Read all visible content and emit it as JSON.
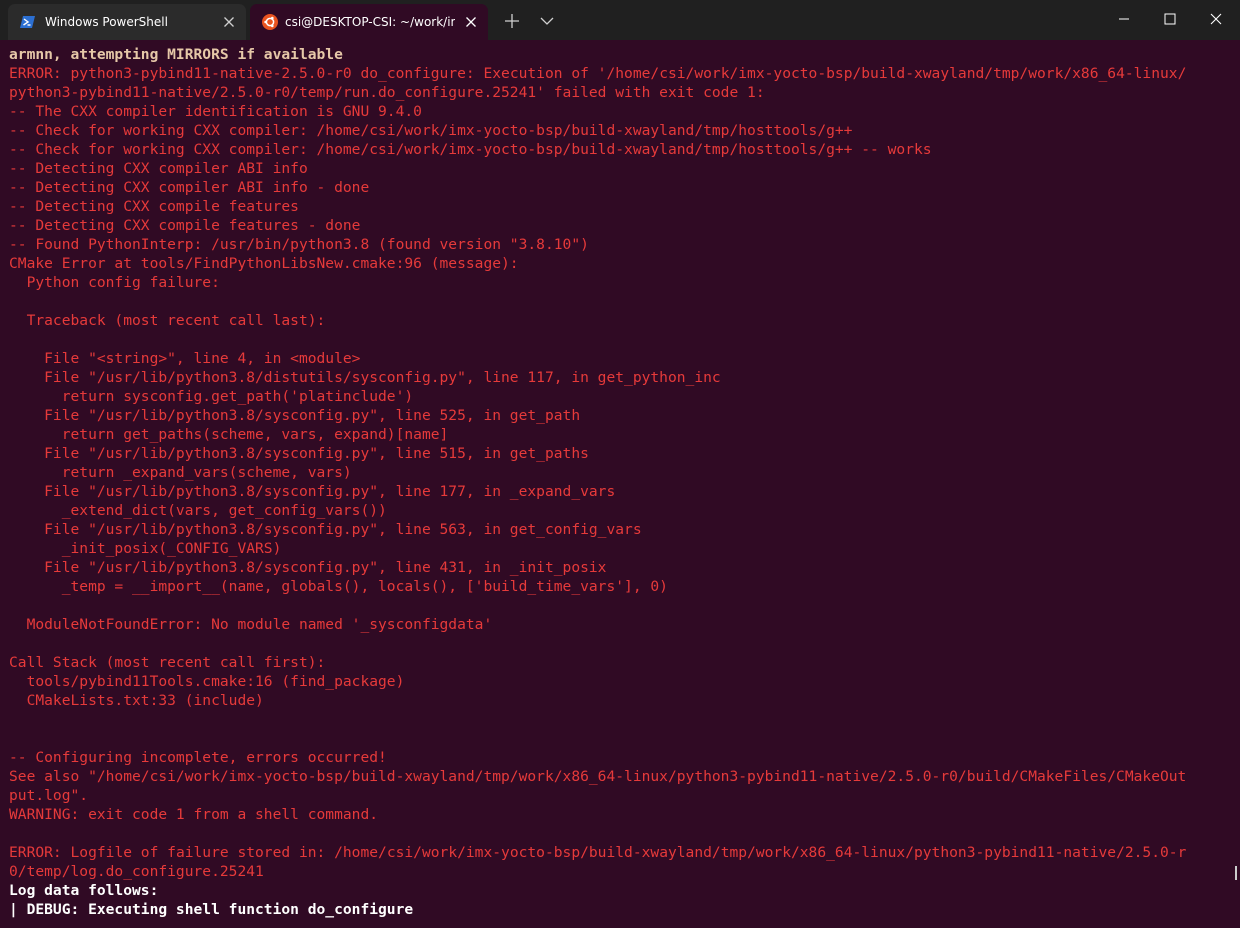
{
  "tabs": [
    {
      "label": "Windows PowerShell",
      "icon": "powershell-icon",
      "active": false
    },
    {
      "label": "csi@DESKTOP-CSI: ~/work/imx",
      "icon": "ubuntu-icon",
      "active": true
    }
  ],
  "colors": {
    "terminal_bg": "#300a24",
    "titlebar_bg": "#202020",
    "error_text": "#ff4d4d",
    "accent_ubuntu": "#e95420"
  },
  "terminal": {
    "lines": [
      {
        "parts": [
          {
            "c": "tan",
            "t": "armnn, attempting MIRRORS if available"
          }
        ]
      },
      {
        "parts": [
          {
            "c": "red",
            "t": "ERROR: "
          },
          {
            "c": "red",
            "t": "python3-pybind11-native-2.5.0-r0 do_configure: Execution of '/home/csi/work/imx-yocto-bsp/build-xwayland/tmp/work/x86_64-linux/"
          }
        ]
      },
      {
        "parts": [
          {
            "c": "red",
            "t": "python3-pybind11-native/2.5.0-r0/temp/run.do_configure.25241' failed with exit code 1:"
          }
        ]
      },
      {
        "parts": [
          {
            "c": "red",
            "t": "-- The CXX compiler identification is GNU 9.4.0"
          }
        ]
      },
      {
        "parts": [
          {
            "c": "red",
            "t": "-- Check for working CXX compiler: /home/csi/work/imx-yocto-bsp/build-xwayland/tmp/hosttools/g++"
          }
        ]
      },
      {
        "parts": [
          {
            "c": "red",
            "t": "-- Check for working CXX compiler: /home/csi/work/imx-yocto-bsp/build-xwayland/tmp/hosttools/g++ -- works"
          }
        ]
      },
      {
        "parts": [
          {
            "c": "red",
            "t": "-- Detecting CXX compiler ABI info"
          }
        ]
      },
      {
        "parts": [
          {
            "c": "red",
            "t": "-- Detecting CXX compiler ABI info - done"
          }
        ]
      },
      {
        "parts": [
          {
            "c": "red",
            "t": "-- Detecting CXX compile features"
          }
        ]
      },
      {
        "parts": [
          {
            "c": "red",
            "t": "-- Detecting CXX compile features - done"
          }
        ]
      },
      {
        "parts": [
          {
            "c": "red",
            "t": "-- Found PythonInterp: /usr/bin/python3.8 (found version \"3.8.10\")"
          }
        ]
      },
      {
        "parts": [
          {
            "c": "red",
            "t": "CMake Error at tools/FindPythonLibsNew.cmake:96 (message):"
          }
        ]
      },
      {
        "parts": [
          {
            "c": "red",
            "t": "  Python config failure:"
          }
        ]
      },
      {
        "parts": [
          {
            "c": "red",
            "t": ""
          }
        ]
      },
      {
        "parts": [
          {
            "c": "red",
            "t": "  Traceback (most recent call last):"
          }
        ]
      },
      {
        "parts": [
          {
            "c": "red",
            "t": ""
          }
        ]
      },
      {
        "parts": [
          {
            "c": "red",
            "t": "    File \"<string>\", line 4, in <module>"
          }
        ]
      },
      {
        "parts": [
          {
            "c": "red",
            "t": "    File \"/usr/lib/python3.8/distutils/sysconfig.py\", line 117, in get_python_inc"
          }
        ]
      },
      {
        "parts": [
          {
            "c": "red",
            "t": "      return sysconfig.get_path('platinclude')"
          }
        ]
      },
      {
        "parts": [
          {
            "c": "red",
            "t": "    File \"/usr/lib/python3.8/sysconfig.py\", line 525, in get_path"
          }
        ]
      },
      {
        "parts": [
          {
            "c": "red",
            "t": "      return get_paths(scheme, vars, expand)[name]"
          }
        ]
      },
      {
        "parts": [
          {
            "c": "red",
            "t": "    File \"/usr/lib/python3.8/sysconfig.py\", line 515, in get_paths"
          }
        ]
      },
      {
        "parts": [
          {
            "c": "red",
            "t": "      return _expand_vars(scheme, vars)"
          }
        ]
      },
      {
        "parts": [
          {
            "c": "red",
            "t": "    File \"/usr/lib/python3.8/sysconfig.py\", line 177, in _expand_vars"
          }
        ]
      },
      {
        "parts": [
          {
            "c": "red",
            "t": "      _extend_dict(vars, get_config_vars())"
          }
        ]
      },
      {
        "parts": [
          {
            "c": "red",
            "t": "    File \"/usr/lib/python3.8/sysconfig.py\", line 563, in get_config_vars"
          }
        ]
      },
      {
        "parts": [
          {
            "c": "red",
            "t": "      _init_posix(_CONFIG_VARS)"
          }
        ]
      },
      {
        "parts": [
          {
            "c": "red",
            "t": "    File \"/usr/lib/python3.8/sysconfig.py\", line 431, in _init_posix"
          }
        ]
      },
      {
        "parts": [
          {
            "c": "red",
            "t": "      _temp = __import__(name, globals(), locals(), ['build_time_vars'], 0)"
          }
        ]
      },
      {
        "parts": [
          {
            "c": "red",
            "t": ""
          }
        ]
      },
      {
        "parts": [
          {
            "c": "red",
            "t": "  ModuleNotFoundError: No module named '_sysconfigdata'"
          }
        ]
      },
      {
        "parts": [
          {
            "c": "red",
            "t": ""
          }
        ]
      },
      {
        "parts": [
          {
            "c": "red",
            "t": "Call Stack (most recent call first):"
          }
        ]
      },
      {
        "parts": [
          {
            "c": "red",
            "t": "  tools/pybind11Tools.cmake:16 (find_package)"
          }
        ]
      },
      {
        "parts": [
          {
            "c": "red",
            "t": "  CMakeLists.txt:33 (include)"
          }
        ]
      },
      {
        "parts": [
          {
            "c": "red",
            "t": ""
          }
        ]
      },
      {
        "parts": [
          {
            "c": "red",
            "t": ""
          }
        ]
      },
      {
        "parts": [
          {
            "c": "red",
            "t": "-- Configuring incomplete, errors occurred!"
          }
        ]
      },
      {
        "parts": [
          {
            "c": "red",
            "t": "See also \"/home/csi/work/imx-yocto-bsp/build-xwayland/tmp/work/x86_64-linux/python3-pybind11-native/2.5.0-r0/build/CMakeFiles/CMakeOut"
          }
        ]
      },
      {
        "parts": [
          {
            "c": "red",
            "t": "put.log\"."
          }
        ]
      },
      {
        "parts": [
          {
            "c": "red",
            "t": "WARNING: exit code 1 from a shell command."
          }
        ]
      },
      {
        "parts": [
          {
            "c": "red",
            "t": ""
          }
        ]
      },
      {
        "parts": [
          {
            "c": "red",
            "t": "ERROR: "
          },
          {
            "c": "red",
            "t": "Logfile of failure stored in: /home/csi/work/imx-yocto-bsp/build-xwayland/tmp/work/x86_64-linux/python3-pybind11-native/2.5.0-r"
          }
        ]
      },
      {
        "parts": [
          {
            "c": "red",
            "t": "0/temp/log.do_configure.25241"
          }
        ]
      },
      {
        "parts": [
          {
            "c": "white",
            "t": "Log data follows:"
          }
        ]
      },
      {
        "parts": [
          {
            "c": "white",
            "t": "| DEBUG: Executing shell function do_configure"
          }
        ]
      }
    ]
  }
}
